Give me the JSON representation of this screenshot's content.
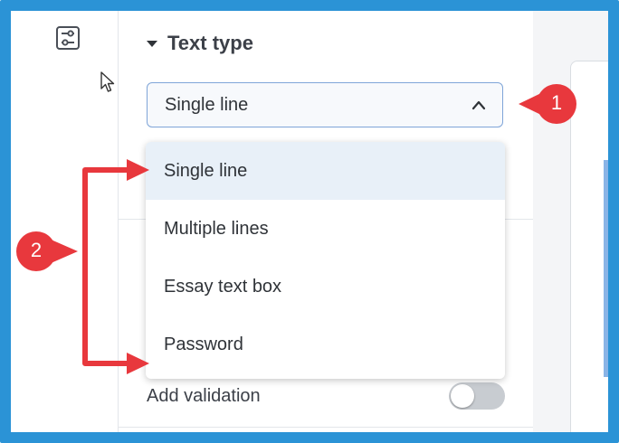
{
  "sidebar": {
    "icon": "sliders-icon"
  },
  "section": {
    "title": "Text type"
  },
  "select": {
    "value": "Single line"
  },
  "dropdown": {
    "options": [
      "Single line",
      "Multiple lines",
      "Essay text box",
      "Password"
    ],
    "selected_index": 0
  },
  "validation": {
    "label": "Add validation",
    "enabled": false
  },
  "annotations": {
    "badge_1": "1",
    "badge_2": "2"
  },
  "colors": {
    "frame": "#2b93d6",
    "annotation_red": "#e8383d",
    "selected_option_bg": "#e8f0f8",
    "select_border": "#7fa5d8"
  }
}
